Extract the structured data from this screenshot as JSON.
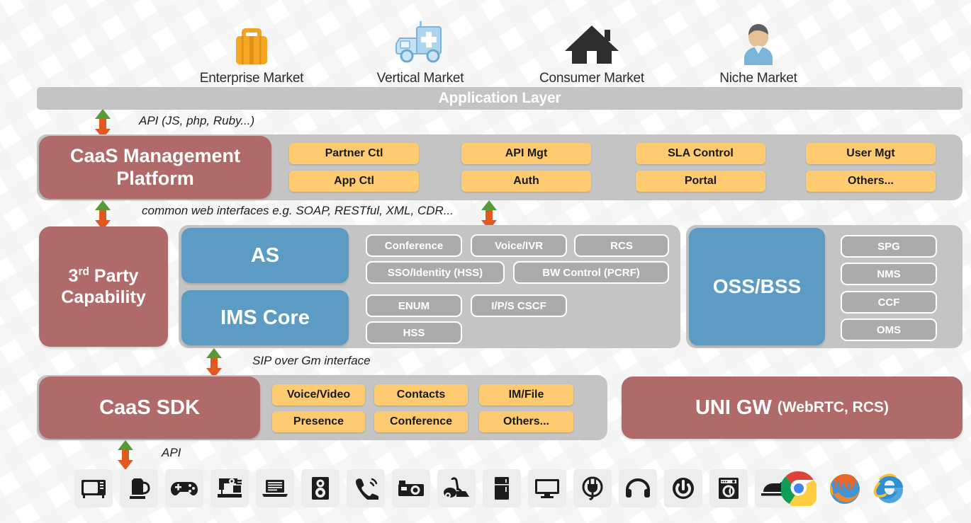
{
  "markets": [
    {
      "label": "Enterprise Market",
      "icon": "briefcase-icon"
    },
    {
      "label": "Vertical Market",
      "icon": "ambulance-icon"
    },
    {
      "label": "Consumer Market",
      "icon": "house-icon"
    },
    {
      "label": "Niche Market",
      "icon": "person-icon"
    }
  ],
  "application_layer": {
    "label": "Application Layer"
  },
  "annotations": {
    "api_top": "API (JS, php, Ruby...)",
    "common_web": "common web interfaces e.g. SOAP, RESTful, XML, CDR...",
    "sip": "SIP over Gm interface",
    "api_bottom": "API"
  },
  "caas_platform": {
    "title_line1": "CaaS Management",
    "title_line2": "Platform",
    "chips": [
      "Partner Ctl",
      "App Ctl",
      "API Mgt",
      "Auth",
      "SLA Control",
      "Portal",
      "User Mgt",
      "Others..."
    ]
  },
  "third_party": {
    "title_pre": "3",
    "title_sup": "rd",
    "title_mid": " Party",
    "title_line2": "Capability"
  },
  "as_block": {
    "title": "AS",
    "chips_row1": [
      "Conference",
      "Voice/IVR",
      "RCS"
    ],
    "chips_row2": [
      "SSO/Identity (HSS)",
      "BW Control (PCRF)"
    ]
  },
  "ims_block": {
    "title": "IMS Core",
    "chips_row1": [
      "ENUM",
      "I/P/S CSCF"
    ],
    "chips_row2": [
      "HSS"
    ]
  },
  "oss_block": {
    "title": "OSS/BSS",
    "chips": [
      "SPG",
      "NMS",
      "CCF",
      "OMS"
    ]
  },
  "sdk_block": {
    "title": "CaaS SDK",
    "chips": [
      "Voice/Video",
      "Contacts",
      "IM/File",
      "Presence",
      "Conference",
      "Others..."
    ]
  },
  "uni_gw": {
    "title": "UNI GW",
    "subtitle": "(WebRTC, RCS)"
  },
  "devices": [
    "microwave-icon",
    "kettle-icon",
    "gamepad-icon",
    "sewing-machine-icon",
    "laptop-icon",
    "speaker-icon",
    "telephone-icon",
    "camera-icon",
    "vacuum-icon",
    "refrigerator-icon",
    "monitor-icon",
    "power-plug-icon",
    "headphones-icon",
    "power-button-icon",
    "washing-machine-icon",
    "iron-icon"
  ],
  "browsers": [
    "chrome-icon",
    "firefox-icon",
    "internet-explorer-icon"
  ],
  "colors": {
    "maroon": "#b06a6a",
    "blue": "#5b9bc4",
    "yellow": "#ffcb70",
    "gray_bar": "#c4c4c4",
    "gray_chip": "#ababab",
    "arrow_up": "#4f8a2e",
    "arrow_down": "#e2591f"
  }
}
